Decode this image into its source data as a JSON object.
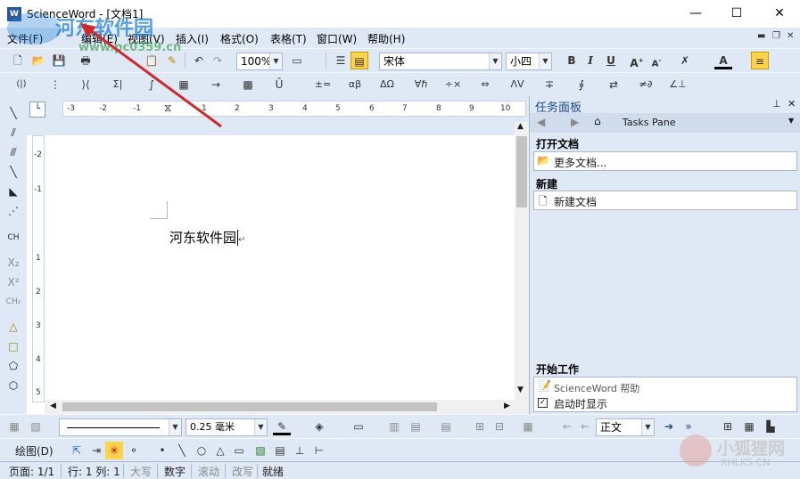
{
  "window": {
    "title": "ScienceWord - [文档1]",
    "app_icon_text": "W",
    "minimize": "—",
    "maximize": "☐",
    "close": "✕"
  },
  "menu": [
    {
      "label": "文件(F)"
    },
    {
      "label": "编辑(E)"
    },
    {
      "label": "视图(V)"
    },
    {
      "label": "插入(I)"
    },
    {
      "label": "格式(O)"
    },
    {
      "label": "表格(T)"
    },
    {
      "label": "窗口(W)"
    },
    {
      "label": "帮助(H)"
    }
  ],
  "toolbar": {
    "zoom": "100%",
    "font_name": "宋体",
    "font_size": "小四",
    "bold": "B",
    "italic": "I",
    "underline": "U"
  },
  "formula_toolbar": {
    "items": [
      "(|)",
      "Σ|",
      "±=",
      "αβ",
      "ΔΩ",
      "∀ℏ",
      "÷×",
      "⇔",
      "ΛV",
      "≠∂",
      "∠⊥"
    ]
  },
  "ruler": {
    "h_numbers": [
      "-3",
      "-2",
      "-1",
      "1",
      "2",
      "3",
      "4",
      "5",
      "6",
      "7",
      "8",
      "9",
      "10"
    ],
    "v_numbers": [
      "-2",
      "-1",
      "1",
      "2",
      "3",
      "4",
      "5"
    ]
  },
  "document": {
    "text": "河东软件园",
    "para_mark": "↵"
  },
  "task_pane": {
    "title": "任务面板",
    "nav_label": "Tasks Pane",
    "sections": {
      "open": {
        "heading": "打开文档",
        "item": "更多文档..."
      },
      "new": {
        "heading": "新建",
        "item": "新建文档"
      },
      "start": {
        "heading": "开始工作",
        "help_item": "ScienceWord 帮助",
        "checkbox_label": "启动时显示",
        "checkbox_checked": true
      }
    }
  },
  "format_toolbar": {
    "line_width": "0.25 毫米",
    "style": "正文"
  },
  "draw_toolbar": {
    "draw_label": "绘图(D)"
  },
  "status": {
    "page": "页面: 1/1",
    "position": "行: 1 列: 1",
    "caps": "大写",
    "num": "数字",
    "scroll": "滚动",
    "overwrite": "改写",
    "ready": "就绪"
  },
  "watermark": {
    "site": "河东软件园",
    "url": "www.pc0359.cn",
    "brand": "小狐狸网",
    "brand_url": "XHLKS.CN"
  },
  "colors": {
    "chrome": "#dfe8f5",
    "arrow": "#cc2b2b",
    "watermark_blue": "#1f7fd6"
  }
}
